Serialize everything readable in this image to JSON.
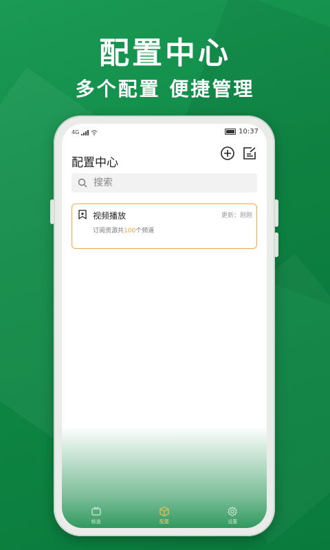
{
  "promo": {
    "headline": "配置中心",
    "subheadline": "多个配置 便捷管理"
  },
  "status_bar": {
    "network": "4G",
    "time": "10:37"
  },
  "app": {
    "title": "配置中心",
    "search_placeholder": "搜索"
  },
  "config_list": [
    {
      "name": "视频播放",
      "updated": "更新：刚刚",
      "desc_prefix": "订阅资源共",
      "desc_count": "100",
      "desc_suffix": "个频道",
      "icon": "add-bookmark-icon"
    }
  ],
  "tab_bar": [
    {
      "label": "频道",
      "icon": "tv-icon"
    },
    {
      "label": "配置",
      "icon": "box-icon",
      "active": true
    },
    {
      "label": "设置",
      "icon": "gear-icon"
    }
  ],
  "colors": {
    "brand_green": "#0f8a46",
    "card_border": "#f0a94a",
    "highlight_number": "#f0a13a"
  }
}
